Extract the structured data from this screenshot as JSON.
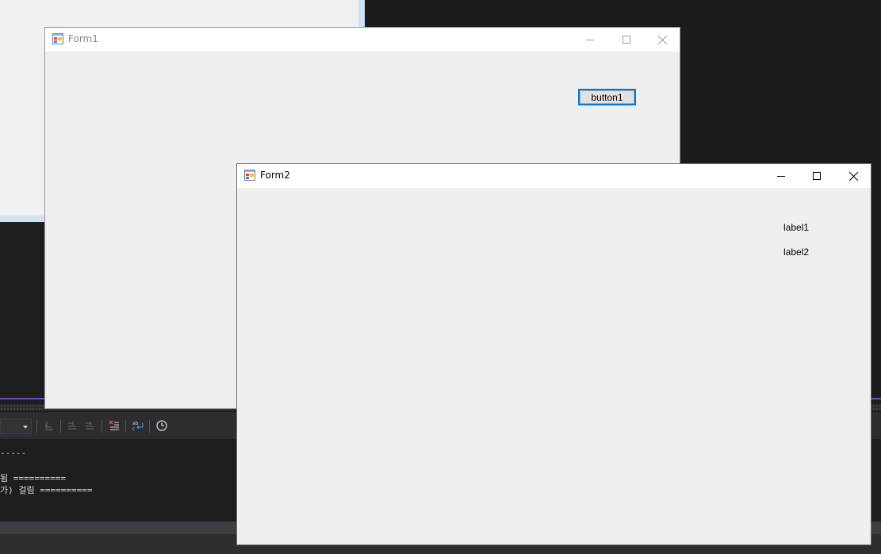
{
  "form1": {
    "title": "Form1",
    "button_label": "button1"
  },
  "form2": {
    "title": "Form2",
    "label1": "label1",
    "label2": "label2"
  },
  "output": {
    "lines": [
      "-----",
      "",
      "됨 ==========",
      "가) 걸림 =========="
    ]
  },
  "colors": {
    "focus_border": "#0078d7",
    "form_background": "#efefef",
    "ide_background": "#1e1e1e",
    "accent_line": "#6a4fbf"
  },
  "icons": {
    "form_icon": "winforms-app-icon",
    "minimize": "minimize-icon",
    "maximize": "maximize-icon",
    "close": "close-icon"
  }
}
